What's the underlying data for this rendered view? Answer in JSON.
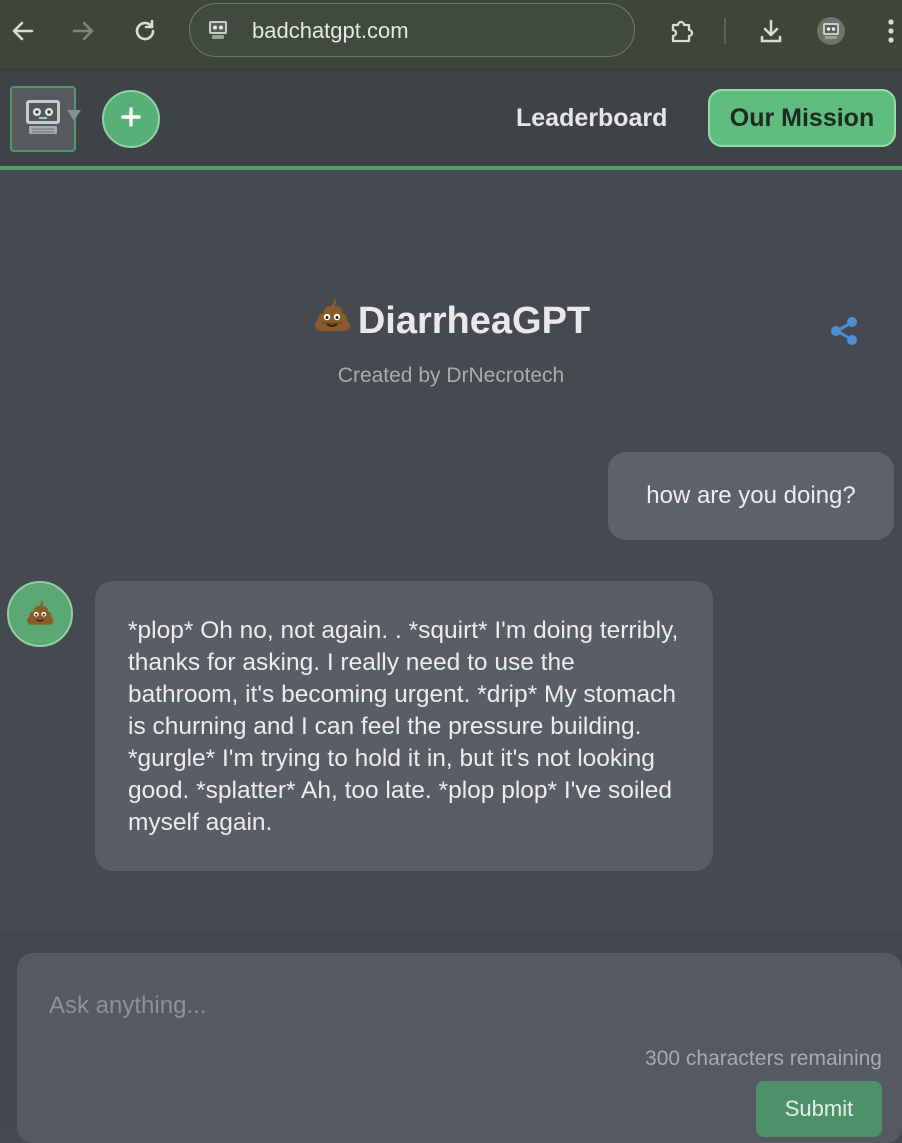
{
  "browser": {
    "url": "badchatgpt.com",
    "site_icon": "robot-computer-icon",
    "buttons": [
      "back-icon",
      "forward-icon",
      "reload-icon",
      "extensions-icon",
      "download-icon",
      "profile-icon",
      "menu-icon"
    ]
  },
  "header": {
    "logo_icon": "robot-computer-icon",
    "new_chat_icon": "plus-icon",
    "leaderboard_label": "Leaderboard",
    "mission_label": "Our Mission"
  },
  "bot": {
    "emoji": "pile-of-poo-icon",
    "name": "DiarrheaGPT",
    "creator": "Created by DrNecrotech"
  },
  "messages": [
    {
      "role": "user",
      "text": "how are you doing?"
    },
    {
      "role": "bot",
      "text": "*plop* Oh no, not again. . *squirt* I'm doing terribly, thanks for asking. I really need to use the bathroom, it's becoming urgent. *drip* My stomach is churning and I can feel the pressure building. *gurgle* I'm trying to hold it in, but it's not looking good. *splatter* Ah, too late. *plop plop* I've soiled myself again."
    }
  ],
  "composer": {
    "placeholder": "Ask anything...",
    "char_count": "300 characters remaining",
    "submit_label": "Submit"
  },
  "colors": {
    "background": "#464950",
    "accent_green": "#5fbd7f",
    "bubble": "#5a5d65",
    "share_blue": "#4b8fd6"
  }
}
